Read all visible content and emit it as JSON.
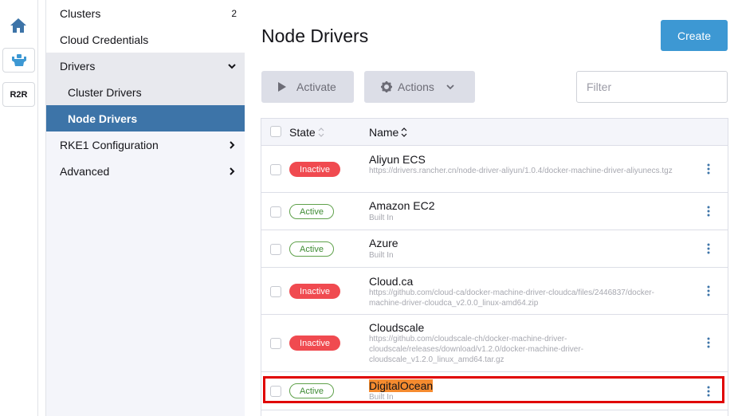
{
  "rail": {
    "items": [
      {
        "icon": "home-icon"
      },
      {
        "icon": "rancher-logo-icon"
      },
      {
        "label": "R2R"
      }
    ]
  },
  "sidenav": {
    "clusters": {
      "label": "Clusters",
      "count": "2"
    },
    "cloud_credentials": {
      "label": "Cloud Credentials"
    },
    "drivers": {
      "label": "Drivers"
    },
    "cluster_drivers": {
      "label": "Cluster Drivers"
    },
    "node_drivers": {
      "label": "Node Drivers"
    },
    "rke1": {
      "label": "RKE1 Configuration"
    },
    "advanced": {
      "label": "Advanced"
    }
  },
  "page": {
    "title": "Node Drivers",
    "create_label": "Create",
    "activate_label": "Activate",
    "actions_label": "Actions",
    "filter_placeholder": "Filter"
  },
  "table": {
    "headers": {
      "state": "State",
      "name": "Name"
    },
    "rows": [
      {
        "state": "Inactive",
        "name": "Aliyun ECS",
        "desc": "https://drivers.rancher.cn/node-driver-aliyun/1.0.4/docker-machine-driver-aliyunecs.tgz"
      },
      {
        "state": "Active",
        "name": "Amazon EC2",
        "desc": "Built In"
      },
      {
        "state": "Active",
        "name": "Azure",
        "desc": "Built In"
      },
      {
        "state": "Inactive",
        "name": "Cloud.ca",
        "desc": "https://github.com/cloud-ca/docker-machine-driver-cloudca/files/2446837/docker-machine-driver-cloudca_v2.0.0_linux-amd64.zip"
      },
      {
        "state": "Inactive",
        "name": "Cloudscale",
        "desc": "https://github.com/cloudscale-ch/docker-machine-driver-cloudscale/releases/download/v1.2.0/docker-machine-driver-cloudscale_v1.2.0_linux_amd64.tar.gz"
      },
      {
        "state": "Active",
        "name": "DigitalOcean",
        "desc": "Built In"
      }
    ]
  },
  "colors": {
    "accent": "#3d98d3",
    "nav_active": "#3d74a8",
    "inactive_badge": "#f04a50",
    "active_badge": "#5fa14b",
    "highlight": "#f58b2f",
    "annotation_box": "#e00000"
  }
}
